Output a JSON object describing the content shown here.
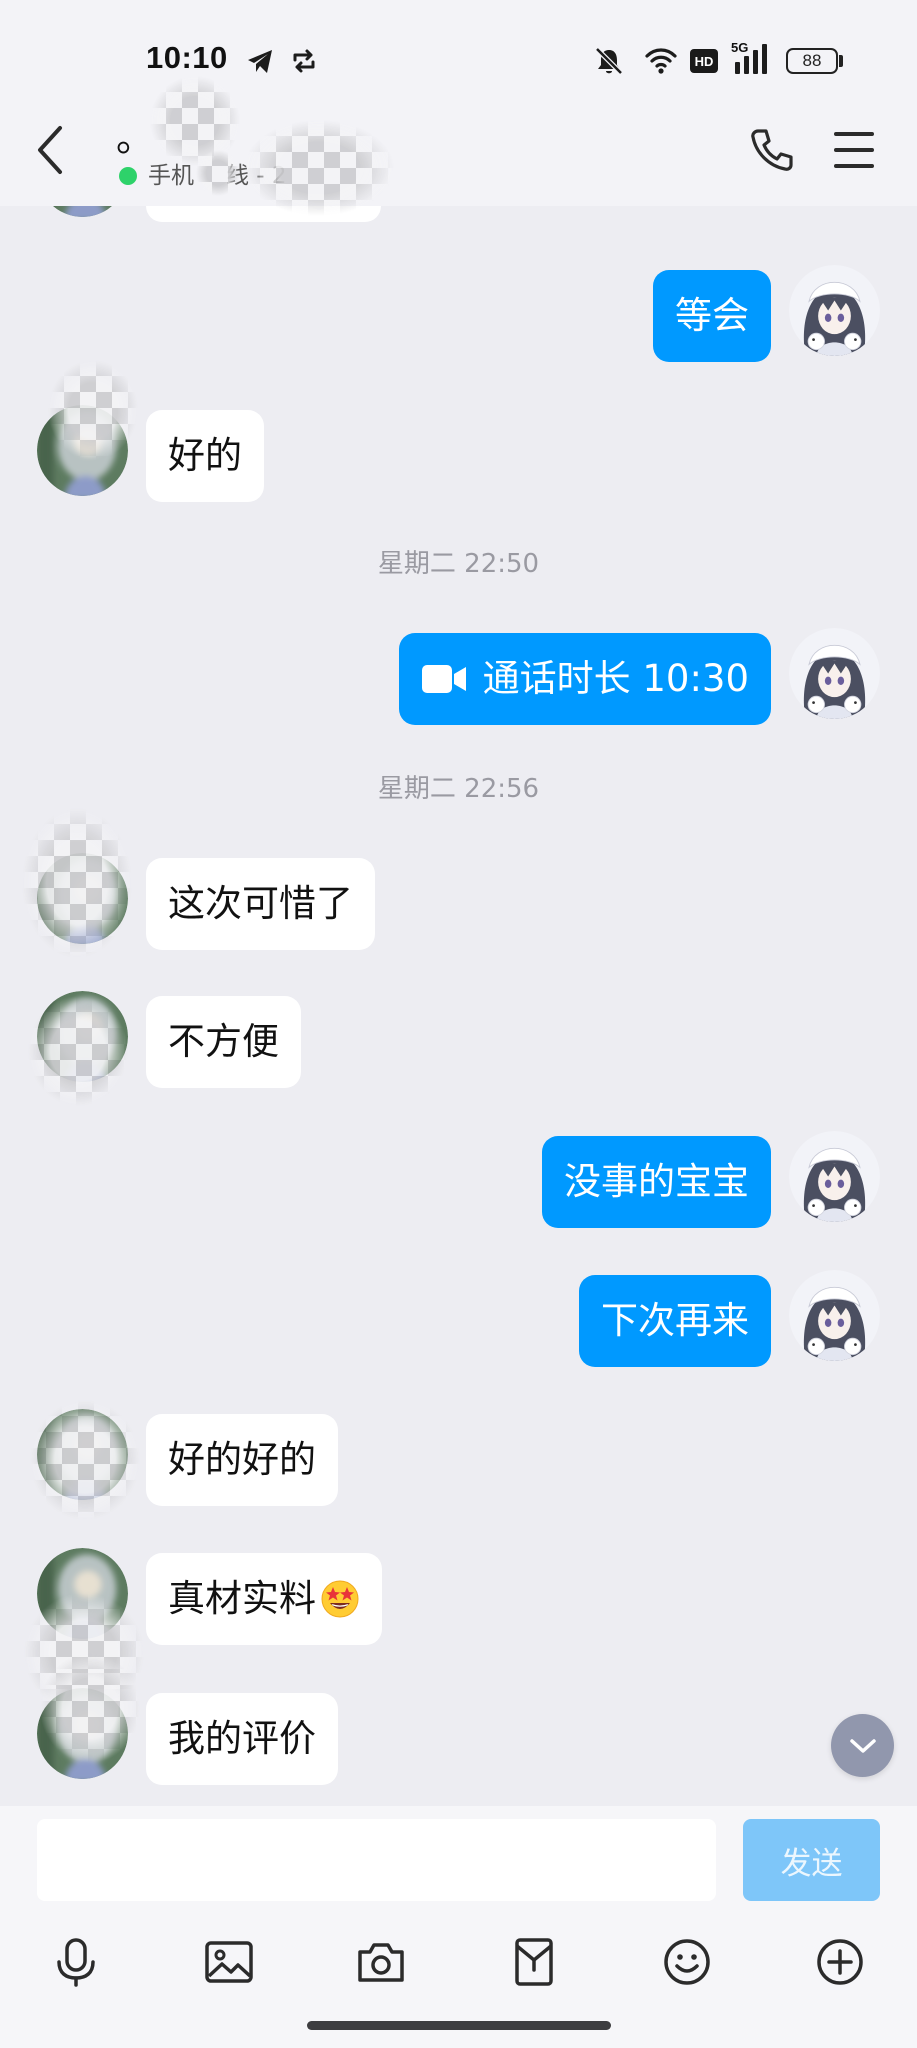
{
  "status_bar": {
    "time": "10:10",
    "network_hd": "HD",
    "network_gen": "5G",
    "battery": "88",
    "icons": [
      "telegram-icon",
      "sync-icon",
      "bell-off-icon",
      "wifi-icon",
      "signal-icon",
      "battery-icon"
    ]
  },
  "header": {
    "contact_name": "。",
    "presence_prefix": "手机",
    "presence_suffix": "线 - 2",
    "icons": [
      "back-chevron-icon",
      "phone-icon",
      "menu-icon"
    ]
  },
  "chat": {
    "messages": [
      {
        "side": "right",
        "type": "text",
        "text": "等会"
      },
      {
        "side": "left",
        "type": "text",
        "text": "好的"
      },
      {
        "type": "timestamp",
        "text": "星期二 22:50"
      },
      {
        "side": "right",
        "type": "video_call",
        "icon": "video-camera-icon",
        "text": "通话时长 10:30"
      },
      {
        "type": "timestamp",
        "text": "星期二 22:56"
      },
      {
        "side": "left",
        "type": "text",
        "text": "这次可惜了"
      },
      {
        "side": "left",
        "type": "text",
        "text": "不方便"
      },
      {
        "side": "right",
        "type": "text",
        "text": "没事的宝宝"
      },
      {
        "side": "right",
        "type": "text",
        "text": "下次再来"
      },
      {
        "side": "left",
        "type": "text",
        "text": "好的好的"
      },
      {
        "side": "left",
        "type": "text",
        "text": "真材实料",
        "emoji": "star-struck-emoji"
      },
      {
        "side": "left",
        "type": "text",
        "text": "我的评价"
      }
    ]
  },
  "composer": {
    "input_value": "",
    "send_label": "发送"
  },
  "toolbar": {
    "icons": [
      "microphone-icon",
      "image-icon",
      "camera-icon",
      "red-packet-icon",
      "emoji-icon",
      "plus-circle-icon"
    ]
  },
  "colors": {
    "sent_bubble": "#0099ff",
    "received_bubble": "#ffffff",
    "chat_background": "#ededf2",
    "header_background": "#f3f3f7",
    "send_button": "#7ec6f9",
    "presence_dot": "#2ed26a",
    "scroll_button": "#9197ad"
  }
}
